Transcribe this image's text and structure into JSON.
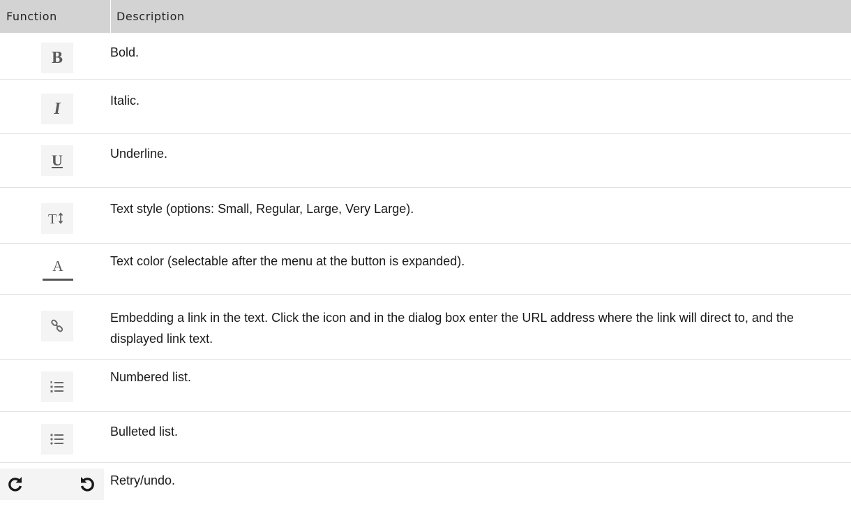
{
  "table": {
    "headers": {
      "function": "Function",
      "description": "Description"
    },
    "rows": [
      {
        "icon": "bold-icon",
        "glyph": "B",
        "description": "Bold."
      },
      {
        "icon": "italic-icon",
        "glyph": "I",
        "description": "Italic."
      },
      {
        "icon": "underline-icon",
        "glyph": "U",
        "description": "Underline."
      },
      {
        "icon": "text-style-icon",
        "glyph": "T↕",
        "description": "Text style (options: Small, Regular, Large, Very Large)."
      },
      {
        "icon": "text-color-icon",
        "glyph": "A",
        "description": "Text color (selectable after the menu at the button is expanded)."
      },
      {
        "icon": "link-icon",
        "glyph": "⚭",
        "description": "Embedding a link in the text. Click the icon and in the dialog box enter the URL address where the link will direct to, and the displayed link text."
      },
      {
        "icon": "numbered-list-icon",
        "description": "Numbered list."
      },
      {
        "icon": "bulleted-list-icon",
        "description": "Bulleted list."
      },
      {
        "icon": "redo-undo-icons",
        "description": "Retry/undo."
      }
    ]
  },
  "colors": {
    "header_bg": "#d3d3d3",
    "icon_bg": "#f4f4f4",
    "icon_fg": "#5a5a5a"
  }
}
